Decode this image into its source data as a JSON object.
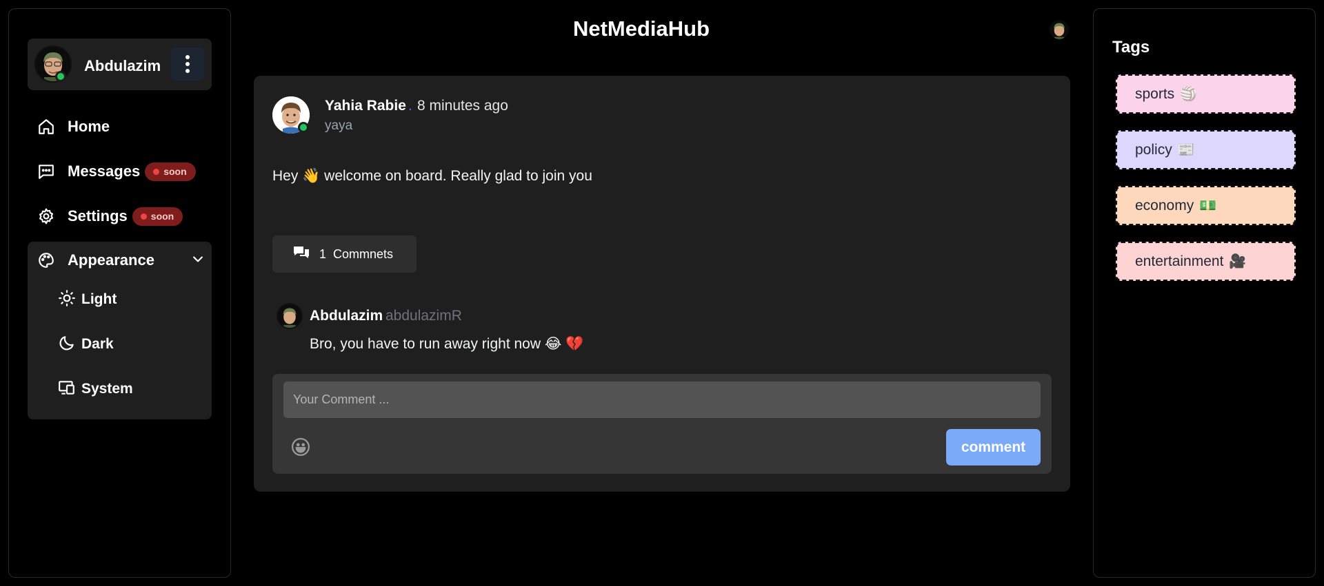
{
  "app": {
    "title": "NetMediaHub"
  },
  "user": {
    "name": "Abdulazim"
  },
  "nav": {
    "items": [
      {
        "label": "Home"
      },
      {
        "label": "Messages",
        "badge": "soon"
      },
      {
        "label": "Settings",
        "badge": "soon"
      }
    ],
    "appearance": {
      "label": "Appearance",
      "options": [
        {
          "label": "Light"
        },
        {
          "label": "Dark"
        },
        {
          "label": "System"
        }
      ]
    }
  },
  "post": {
    "author": "Yahia Rabie",
    "separator": ".",
    "time": "8 minutes ago",
    "handle": "yaya",
    "body": "Hey 👋 welcome on board. Really glad to join you",
    "comments_count": "1",
    "comments_label": "Commnets"
  },
  "comment": {
    "author": "Abdulazim",
    "handle": "abdulazimR",
    "text": "Bro, you have to run away right now 😂 💔"
  },
  "comment_form": {
    "placeholder": "Your Comment ...",
    "submit_label": "comment"
  },
  "tags": {
    "title": "Tags",
    "items": [
      {
        "label": "sports",
        "emoji": "🏐",
        "color": "#fbd3ea"
      },
      {
        "label": "policy",
        "emoji": "📰",
        "color": "#ddd7fd"
      },
      {
        "label": "economy",
        "emoji": "💵",
        "color": "#fed8bd"
      },
      {
        "label": "entertainment",
        "emoji": "🎥",
        "color": "#fdd3d3"
      }
    ]
  },
  "colors": {
    "online": "#22c55e",
    "badge_bg": "#7f1d1d",
    "accent_button": "#7aaaf8"
  },
  "icons": {
    "home": "home-icon",
    "messages": "chat-icon",
    "settings": "gear-icon",
    "appearance": "palette-icon",
    "light": "sun-icon",
    "dark": "moon-icon",
    "system": "devices-icon",
    "comments": "chat-bubbles-icon",
    "emoji": "smiley-icon"
  }
}
